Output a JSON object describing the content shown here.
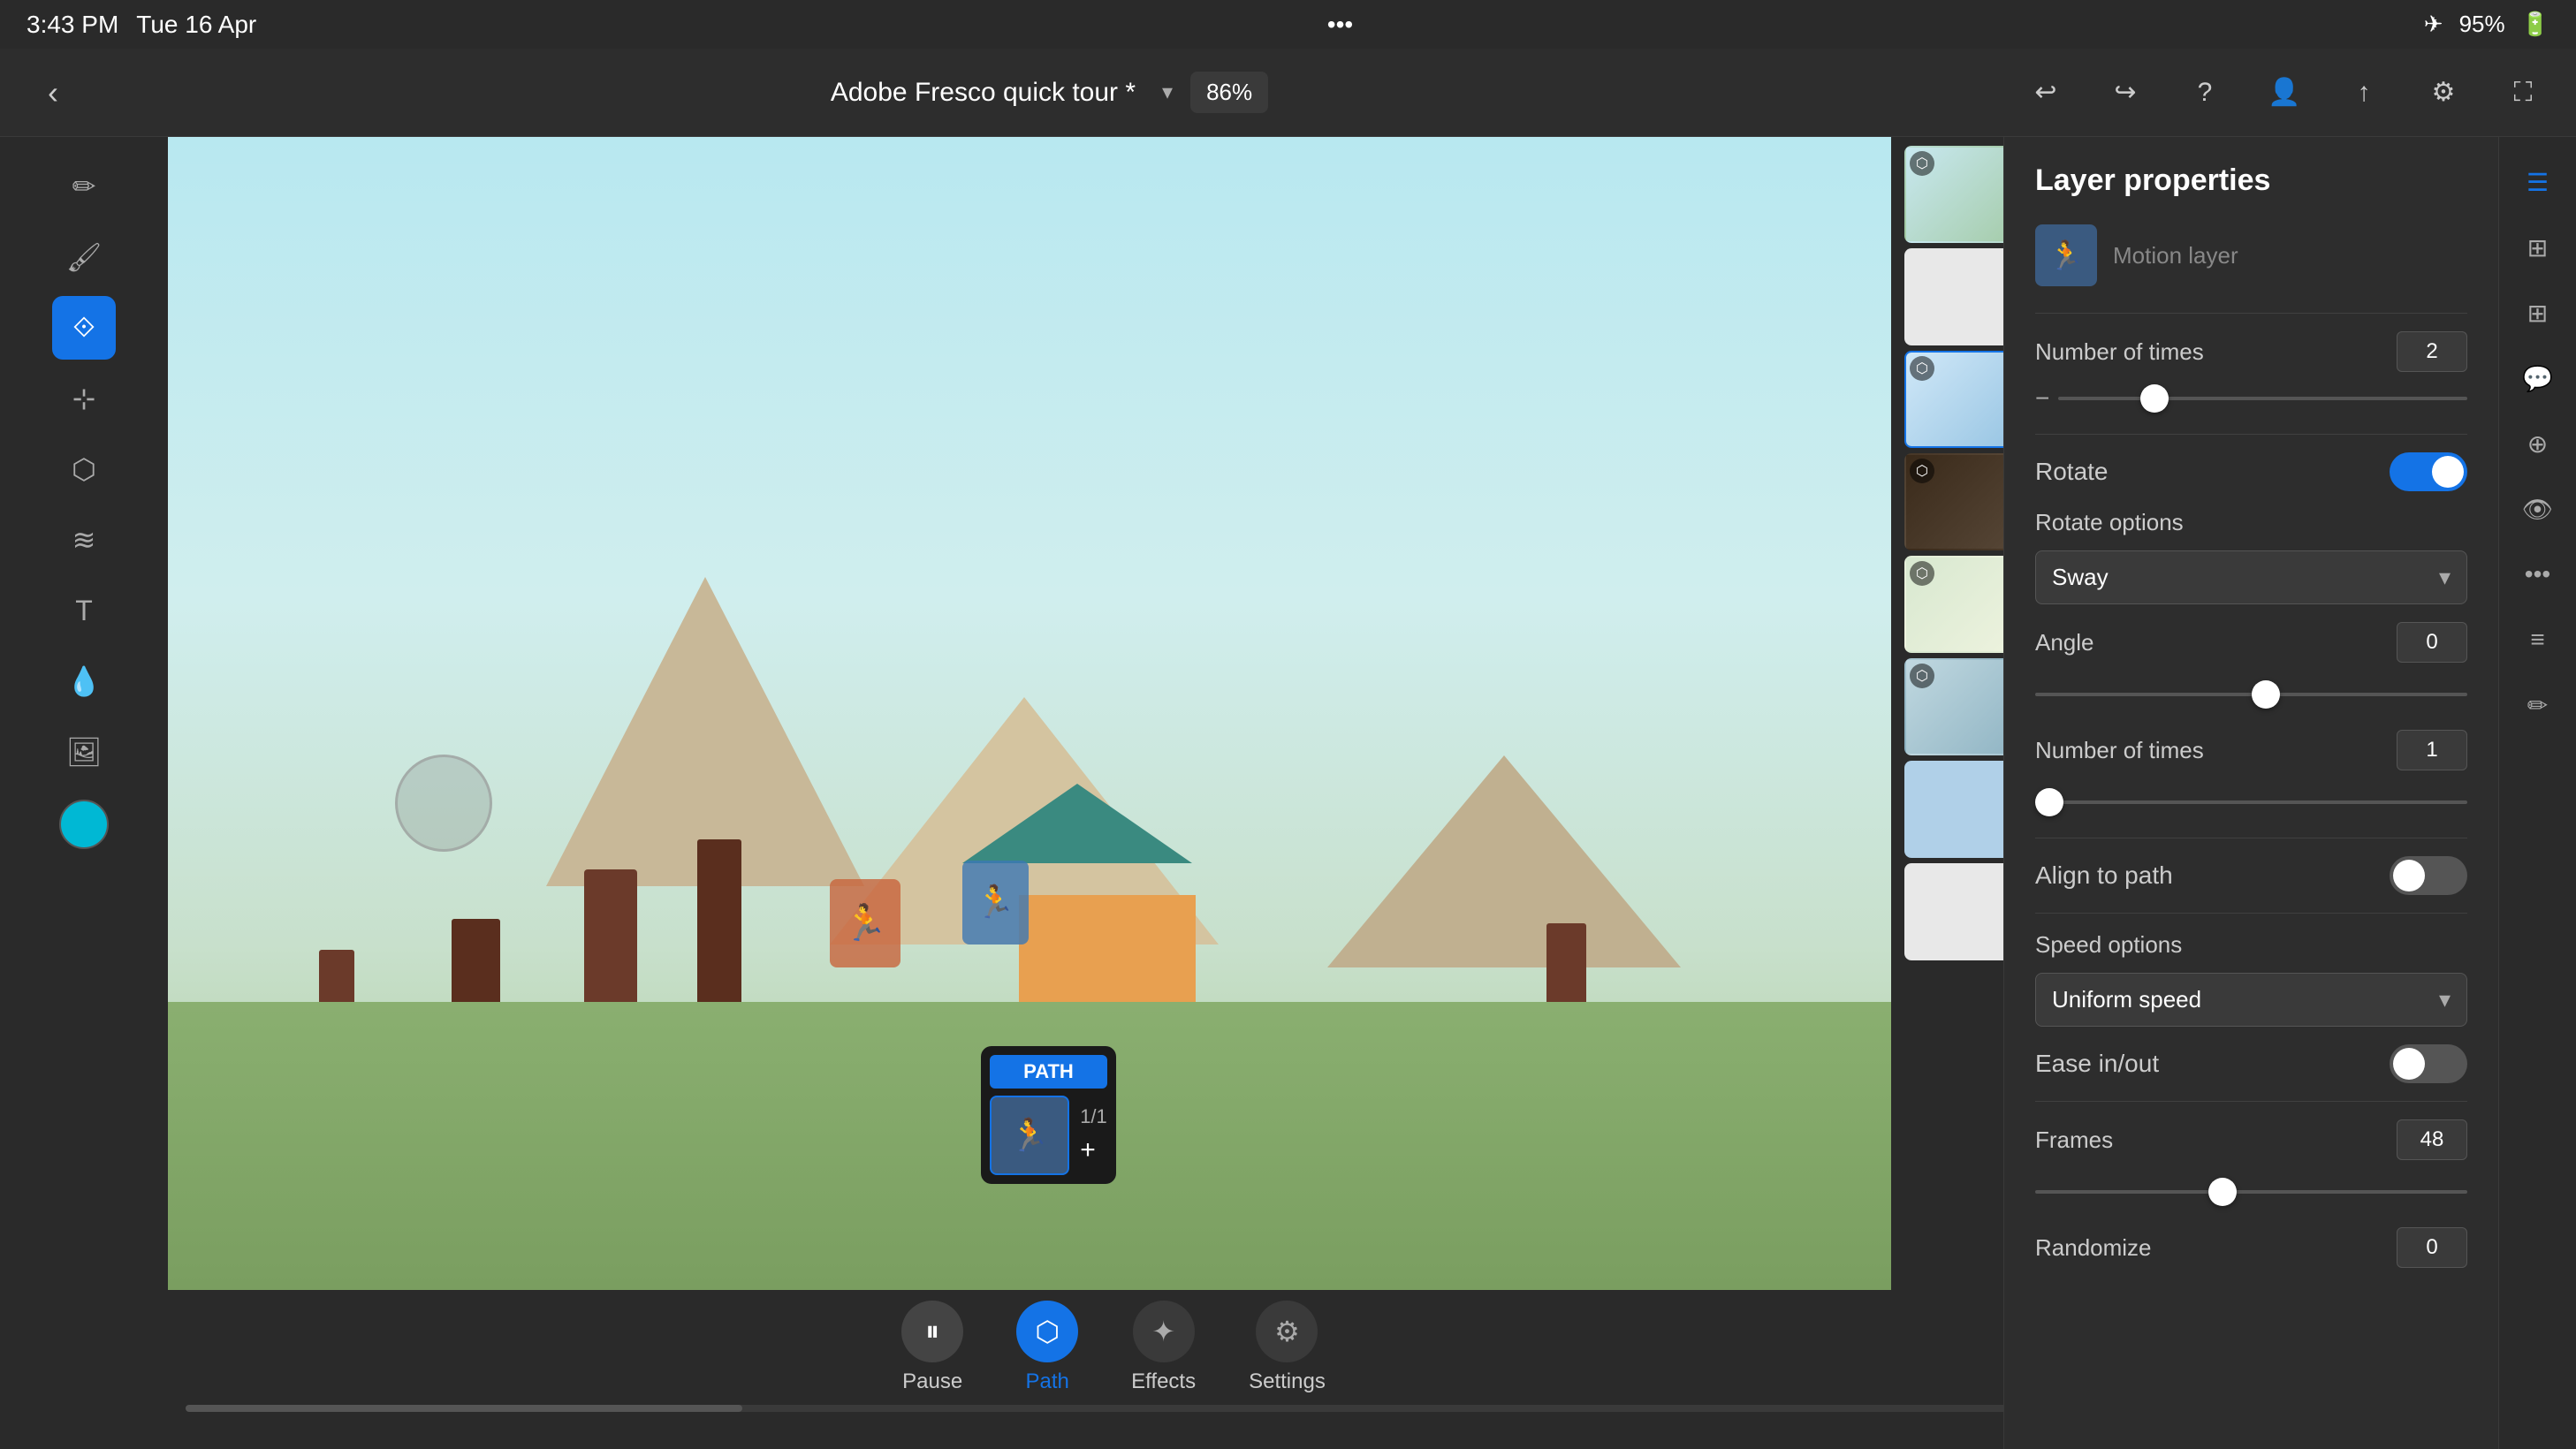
{
  "status": {
    "time": "3:43 PM",
    "date": "Tue 16 Apr",
    "battery": "95%",
    "dots": "•••"
  },
  "toolbar": {
    "back_icon": "‹",
    "project_title": "Adobe Fresco quick tour *",
    "dropdown_arrow": "▾",
    "zoom": "86%",
    "undo_icon": "↩",
    "redo_icon": "↪",
    "help_icon": "?",
    "profile_icon": "👤",
    "share_icon": "↑",
    "settings_icon": "⚙",
    "fullscreen_icon": "⛶"
  },
  "left_tools": {
    "tools": [
      "✏",
      "🖌",
      "✒",
      "⬡",
      "🔄",
      "⟲",
      "T",
      "💧",
      "🖼",
      "🎨"
    ]
  },
  "thumbnails": [
    {
      "id": 1,
      "bg": "thumb-bg-1",
      "has_icon": true
    },
    {
      "id": 2,
      "bg": "thumb-bg-2",
      "has_icon": false
    },
    {
      "id": 3,
      "bg": "thumb-bg-3",
      "has_icon": true,
      "active": true
    },
    {
      "id": 4,
      "bg": "thumb-bg-4",
      "has_icon": true
    },
    {
      "id": 5,
      "bg": "thumb-bg-5",
      "has_icon": true
    },
    {
      "id": 6,
      "bg": "thumb-bg-6",
      "has_icon": true
    },
    {
      "id": 7,
      "bg": "thumb-bg-7",
      "has_icon": false
    },
    {
      "id": 8,
      "bg": "thumb-bg-8",
      "has_icon": false
    }
  ],
  "layer_properties": {
    "title": "Layer properties",
    "motion_layer_label": "Motion layer",
    "num_times_top": {
      "label": "Number of times",
      "value": "2",
      "slider_pos": "20%"
    },
    "rotate": {
      "label": "Rotate",
      "enabled": true
    },
    "rotate_options": {
      "label": "Rotate options",
      "value": "Sway"
    },
    "angle": {
      "label": "Angle",
      "value": "0",
      "slider_pos": "50%"
    },
    "number_of_times": {
      "label": "Number of times",
      "value": "1",
      "slider_pos": "0%"
    },
    "align_to_path": {
      "label": "Align to path",
      "enabled": false
    },
    "speed_options": {
      "label": "Speed options",
      "value": "Uniform speed"
    },
    "ease_in_out": {
      "label": "Ease in/out",
      "enabled": false
    },
    "frames": {
      "label": "Frames",
      "value": "48",
      "slider_pos": "40%"
    },
    "randomize": {
      "label": "Randomize",
      "value": "0"
    }
  },
  "playback": {
    "pause_label": "Pause",
    "path_label": "Path",
    "effects_label": "Effects",
    "settings_label": "Settings",
    "pause_icon": "⏸",
    "path_icon": "⬡",
    "effects_icon": "✦",
    "settings_icon": "⚙"
  },
  "path_popup": {
    "label": "PATH",
    "count": "1/1",
    "add_icon": "+"
  },
  "icon_strip": {
    "icons": [
      "☰",
      "⊞",
      "≡",
      "💬",
      "⊕",
      "👁",
      "🔗",
      "≡",
      "✏"
    ]
  },
  "colors": {
    "accent_blue": "#1473e6",
    "bg_dark": "#2a2a2a",
    "bg_panel": "#2d2d2d",
    "text_primary": "#ffffff",
    "text_secondary": "#cccccc",
    "text_muted": "#888888",
    "toggle_on": "#1473e6",
    "toggle_off": "#555555"
  }
}
